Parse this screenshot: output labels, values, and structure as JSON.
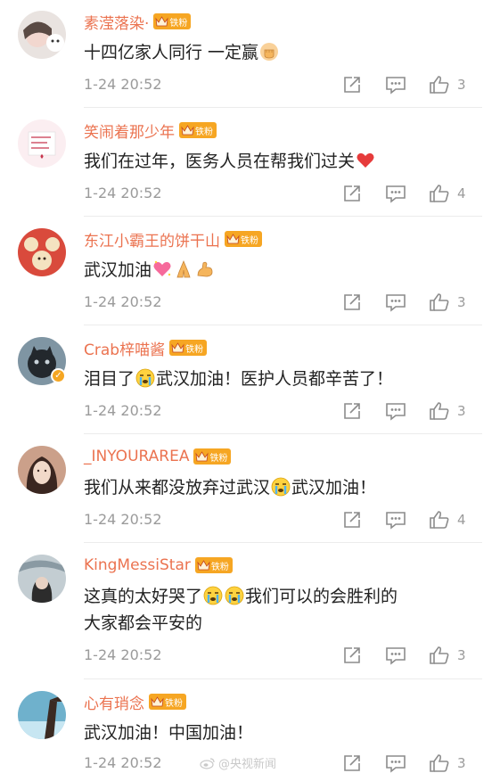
{
  "comments": [
    {
      "username": "素滢落染·",
      "badge": "铁粉",
      "text": "十四亿家人同行  一定赢",
      "time": "1-24 20:52",
      "likes": "3",
      "emojis": [
        "fist"
      ],
      "lines": 1,
      "verified": false,
      "avatar": {
        "bg": "#e9e3e0",
        "fg": "#5a4a44",
        "accent": "#f2d7cf"
      }
    },
    {
      "username": "笑闹着那少年",
      "badge": "铁粉",
      "text": "我们在过年，医务人员在帮我们过关",
      "time": "1-24 20:52",
      "likes": "4",
      "emojis": [
        "heart"
      ],
      "lines": 1,
      "verified": false,
      "avatar": {
        "bg": "#fbeef1",
        "fg": "#c7364e",
        "accent": "#ffffff"
      }
    },
    {
      "username": "东江小霸王的饼干山",
      "badge": "铁粉",
      "text": "武汉加油",
      "time": "1-24 20:52",
      "likes": "3",
      "emojis": [
        "sparkle-heart",
        "pray",
        "muscle"
      ],
      "lines": 1,
      "verified": false,
      "avatar": {
        "bg": "#d94a3c",
        "fg": "#f4e3c0",
        "accent": "#3a2a20"
      }
    },
    {
      "username": "Crab梓喵酱",
      "badge": "铁粉",
      "text": "泪目了",
      "text2": "武汉加油！医护人员都辛苦了！",
      "time": "1-24 20:52",
      "likes": "3",
      "emojis": [
        "cry"
      ],
      "lines": 1,
      "verified": true,
      "avatar": {
        "bg": "#7f95a3",
        "fg": "#23282d",
        "accent": "#c9d3da"
      }
    },
    {
      "username": "_INYOURAREA",
      "badge": "铁粉",
      "text": "我们从来都没放弃过武汉",
      "text2": "武汉加油！",
      "time": "1-24 20:52",
      "likes": "4",
      "emojis": [
        "cry"
      ],
      "lines": 1,
      "verified": false,
      "avatar": {
        "bg": "#cba08a",
        "fg": "#3a2620",
        "accent": "#f1d9c9"
      }
    },
    {
      "username": "KingMessiStar",
      "badge": "铁粉",
      "text": "这真的太好哭了",
      "text2": "我们可以的会胜利的",
      "line2": "大家都会平安的",
      "time": "1-24 20:52",
      "likes": "3",
      "emojis": [
        "cry",
        "cry"
      ],
      "lines": 2,
      "verified": false,
      "avatar": {
        "bg": "#c3cdd2",
        "fg": "#2c2c2c",
        "accent": "#8a9aa3"
      }
    },
    {
      "username": "心有琑念",
      "badge": "铁粉",
      "text": "武汉加油！中国加油！",
      "time": "1-24 20:52",
      "likes": "3",
      "emojis": [],
      "lines": 1,
      "verified": false,
      "avatar": {
        "bg": "#6fb1cc",
        "fg": "#3b2a22",
        "accent": "#c7e6f2"
      }
    }
  ],
  "watermark": "@央视新闻",
  "colors": {
    "username": "#eb7350",
    "badge": "#f6a623",
    "meta": "#9b9b9b",
    "text": "#222222"
  }
}
